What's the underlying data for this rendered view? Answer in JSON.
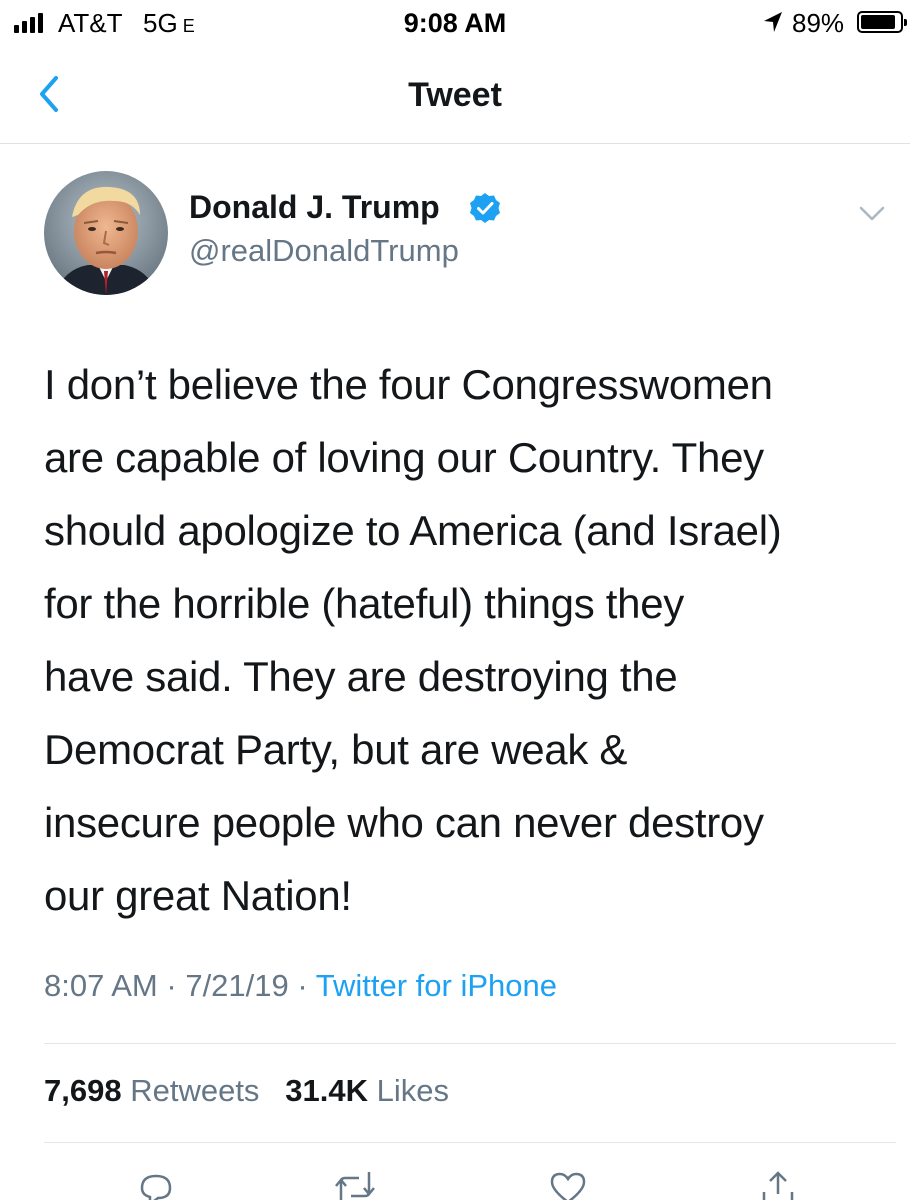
{
  "status_bar": {
    "carrier": "AT&T",
    "network": "5G",
    "network_suffix": "E",
    "time": "9:08 AM",
    "battery_percent_label": "89%",
    "battery_level": 0.89
  },
  "nav": {
    "title": "Tweet",
    "back_icon": "chevron-left-icon"
  },
  "tweet": {
    "author": {
      "display_name": "Donald J. Trump",
      "handle": "@realDonaldTrump",
      "verified_icon": "verified-badge-icon"
    },
    "text_lines": [
      "I don’t believe the four Congresswomen",
      "are capable of loving our Country. They",
      "should apologize to America (and Israel)",
      "for the horrible (hateful) things they",
      "have said. They are destroying the",
      "Democrat Party, but are weak &",
      "insecure people who can never destroy",
      "our great Nation!"
    ],
    "time": "8:07 AM",
    "separator": "·",
    "date": "7/21/19",
    "source": "Twitter for iPhone"
  },
  "stats": {
    "retweets_count": "7,698",
    "retweets_label": "Retweets",
    "likes_count": "31.4K",
    "likes_label": "Likes"
  },
  "actions": [
    "reply-icon",
    "retweet-icon",
    "like-icon",
    "share-icon"
  ],
  "colors": {
    "accent": "#1da1f2",
    "text_primary": "#14171a",
    "text_secondary": "#657786",
    "divider": "#e1e8ed"
  }
}
